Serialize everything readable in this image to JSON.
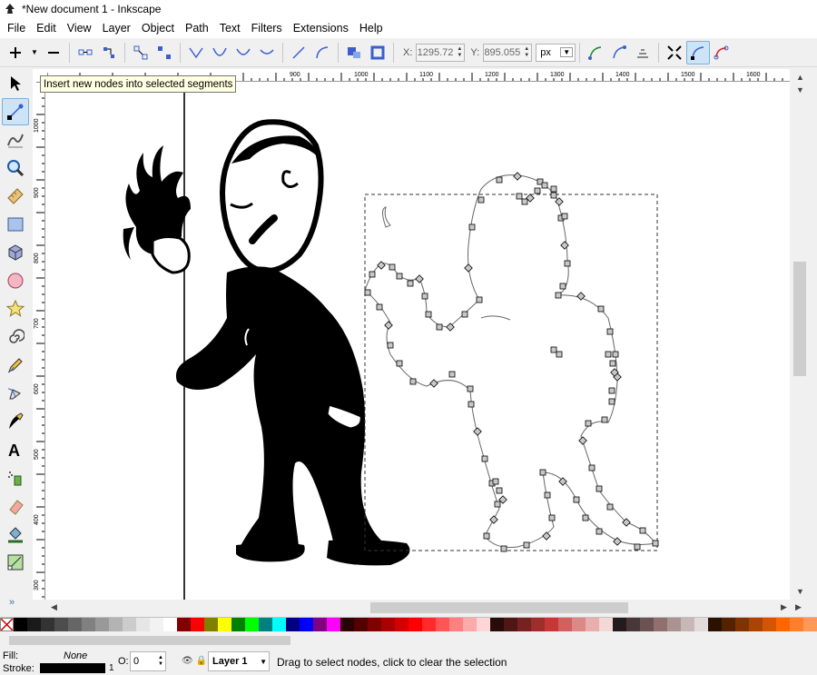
{
  "window": {
    "title": "*New document 1 - Inkscape"
  },
  "menu": [
    "File",
    "Edit",
    "View",
    "Layer",
    "Object",
    "Path",
    "Text",
    "Filters",
    "Extensions",
    "Help"
  ],
  "controls": {
    "x_label": "X:",
    "x_value": "1295.72",
    "y_label": "Y:",
    "y_value": "895.055",
    "unit": "px"
  },
  "tooltip": "Insert new nodes into selected segments",
  "ruler": {
    "h_ticks": [
      "900",
      "1000",
      "1100",
      "1200",
      "1300",
      "1400",
      "1500",
      "1600"
    ],
    "v_ticks": [
      "1000",
      "900",
      "800",
      "700",
      "600",
      "500",
      "400",
      "300"
    ]
  },
  "colors": {
    "accent": "#3a7bd5",
    "node_fill": "#c8c8c8",
    "tooltip_bg": "#ffffe1"
  },
  "palette": [
    "#000000",
    "#1a1a1a",
    "#333333",
    "#4d4d4d",
    "#666666",
    "#808080",
    "#999999",
    "#b3b3b3",
    "#cccccc",
    "#e6e6e6",
    "#f2f2f2",
    "#ffffff",
    "#800000",
    "#ff0000",
    "#808000",
    "#ffff00",
    "#008000",
    "#00ff00",
    "#008080",
    "#00ffff",
    "#000080",
    "#0000ff",
    "#800080",
    "#ff00ff",
    "#2b0000",
    "#550000",
    "#800000",
    "#aa0000",
    "#d40000",
    "#ff0000",
    "#ff2a2a",
    "#ff5555",
    "#ff8080",
    "#ffaaaa",
    "#ffd5d5",
    "#280b0b",
    "#501616",
    "#782121",
    "#a02c2c",
    "#c83737",
    "#d35f5f",
    "#de8787",
    "#e9afaf",
    "#f4d7d7",
    "#241c1c",
    "#483737",
    "#6c5353",
    "#916f6f",
    "#ac9393",
    "#c8b7b7",
    "#e3dbdb",
    "#2b1100",
    "#552200",
    "#803300",
    "#aa4400",
    "#d45500",
    "#ff6600",
    "#ff7f2a",
    "#ff9955"
  ],
  "status": {
    "fill_label": "Fill:",
    "fill_value": "None",
    "stroke_label": "Stroke:",
    "stroke_width": "1",
    "opacity_label": "O:",
    "opacity_value": "0",
    "layer": "Layer 1",
    "message": "Drag to select nodes, click to clear the selection"
  },
  "icons": {
    "tools": [
      "selector-icon",
      "node-tool-icon",
      "tweak-icon",
      "zoom-icon",
      "measure-icon",
      "rect-icon",
      "3dbox-icon",
      "ellipse-icon",
      "star-icon",
      "spiral-icon",
      "pencil-icon",
      "pen-icon",
      "calligraphy-icon",
      "text-icon",
      "spray-icon",
      "eraser-icon",
      "paint-bucket-icon",
      "gradient-icon"
    ]
  }
}
